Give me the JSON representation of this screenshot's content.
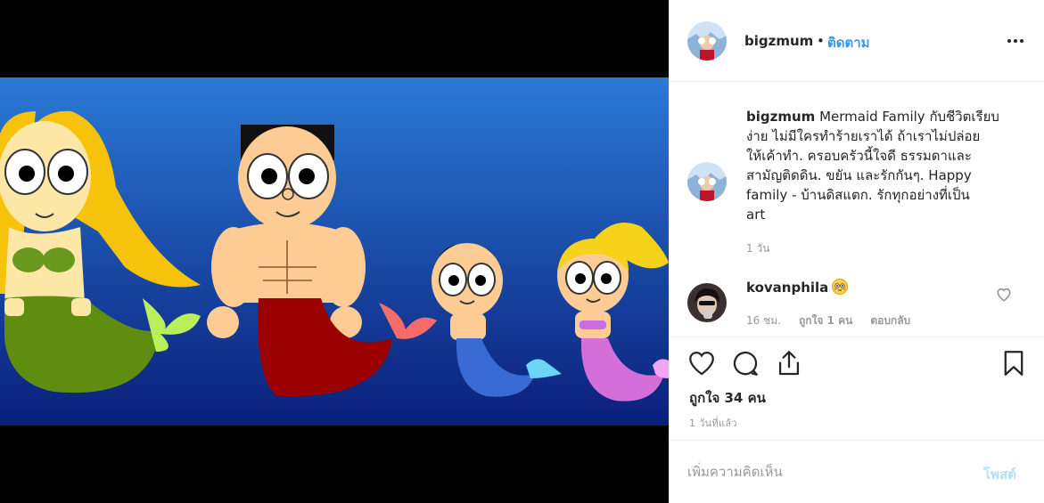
{
  "post": {
    "username": "bigzmum",
    "separator": "•",
    "follow_label": "ติดตาม",
    "more_icon": "more-options-icon",
    "caption": {
      "username": "bigzmum",
      "lines": [
        "Mermaid Family กับชีวิตเรียบ",
        "ง่าย ไม่มีใครทำร้ายเราได้ ถ้าเราไม่ปล่อย",
        "ให้เค้าทำ. ครอบครัวนี้ใจดี ธรรมดาและ",
        "สามัญติดดิน. ขยัน และรักกันๆ. Happy",
        "family - บ้านดิสแตก. รักทุกอย่างที่เป็น",
        "art"
      ],
      "time": "1 วัน"
    },
    "comment": {
      "username": "kovanphila",
      "emoji_icon": "flushed-face-emoji",
      "time": "16 ชม.",
      "likes": "ถูกใจ 1 คน",
      "reply": "ตอบกลับ"
    },
    "likes_count": "ถูกใจ 34 คน",
    "posted_ago": "1 วันที่แล้ว",
    "add_comment_placeholder": "เพิ่มความคิดเห็น",
    "post_label": "โพสต์",
    "colors": {
      "accent": "#3897f0",
      "post_disabled": "#b2dffc",
      "muted": "#999999"
    }
  }
}
